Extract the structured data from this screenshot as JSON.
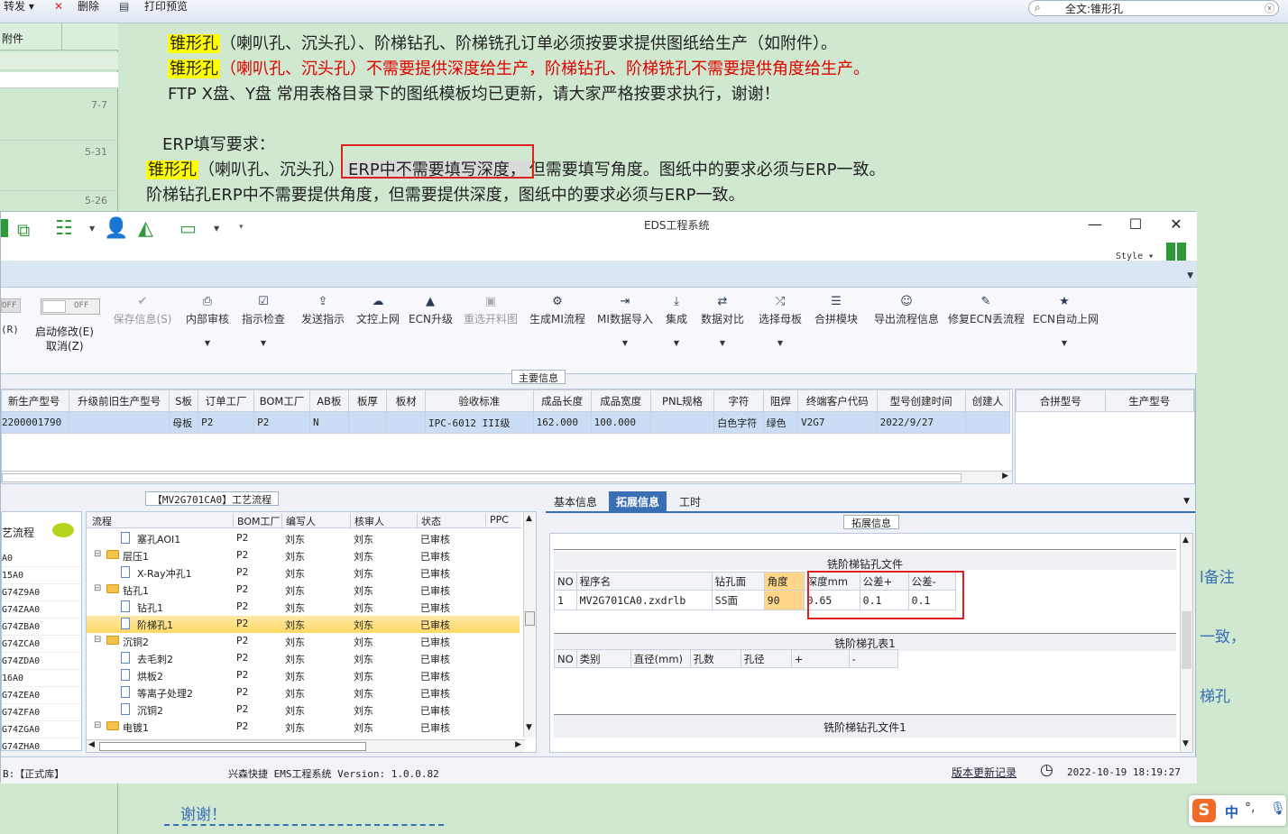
{
  "mail_toolbar": {
    "forward": "转发",
    "delete": "删除",
    "print": "打印预览",
    "search_value": "全文:锥形孔"
  },
  "mail_list": {
    "col_header": "附件",
    "dates": [
      "7-7",
      "5-31",
      "5-26"
    ]
  },
  "mail_body": {
    "line1_hl": "锥形孔",
    "line1": "（喇叭孔、沉头孔）、阶梯钻孔、阶梯铣孔订单必须按要求提供图纸给生产（如附件）。",
    "line2_hl": "锥形孔",
    "line2": "（喇叭孔、沉头孔）不需要提供深度给生产，阶梯钻孔、阶梯铣孔不需要提供角度给生产。",
    "line3": "FTP X盘、Y盘 常用表格目录下的图纸模板均已更新，请大家严格按要求执行，谢谢！",
    "line4": "ERP填写要求：",
    "line5_hl": "锥形孔",
    "line5a": "（喇叭孔、沉头孔）",
    "line5b": "ERP中不需要填写深度，",
    "line5c": "但需要填写角度。图纸中的要求必须与ERP一致。",
    "line6": "阶梯钻孔ERP中不需要提供角度，但需要提供深度，图纸中的要求必须与ERP一致。",
    "thanks": "谢谢！",
    "right_frag1": "l备注",
    "right_frag2": "一致，",
    "right_frag3": "梯孔"
  },
  "window": {
    "title": "EDS工程系统",
    "style_label": "Style"
  },
  "ribbon": {
    "toggle_off": "OFF",
    "left_frag": "(R)",
    "enable_edit": "启动修改(E)",
    "cancel": "取消(Z)",
    "buttons": [
      {
        "icon": "check-icon",
        "label": "保存信息(S)",
        "disabled": true
      },
      {
        "icon": "print-icon",
        "label": "内部审核"
      },
      {
        "icon": "checkbox-icon",
        "label": "指示检查"
      },
      {
        "icon": "upload-icon",
        "label": "发送指示"
      },
      {
        "icon": "cloud-upload-icon",
        "label": "文控上网"
      },
      {
        "icon": "ecn-icon",
        "label": "ECN升级"
      },
      {
        "icon": "image-icon",
        "label": "重选开料图",
        "disabled": true
      },
      {
        "icon": "gears-icon",
        "label": "生成MI流程"
      },
      {
        "icon": "import-icon",
        "label": "MI数据导入"
      },
      {
        "icon": "download-icon",
        "label": "集成"
      },
      {
        "icon": "compare-icon",
        "label": "数据对比"
      },
      {
        "icon": "shuffle-icon",
        "label": "选择母板"
      },
      {
        "icon": "list-icon",
        "label": "合拼模块"
      },
      {
        "icon": "smile-icon",
        "label": "导出流程信息"
      },
      {
        "icon": "wrench-icon",
        "label": "修复ECN丢流程"
      },
      {
        "icon": "star-icon",
        "label": "ECN自动上网"
      }
    ]
  },
  "main_info": {
    "section_title": "主要信息",
    "headers": [
      "新生产型号",
      "升级前旧生产型号",
      "S板",
      "订单工厂",
      "BOM工厂",
      "AB板",
      "板厚",
      "板材",
      "验收标准",
      "成品长度",
      "成品宽度",
      "PNL规格",
      "字符",
      "阻焊",
      "终端客户代码",
      "型号创建时间",
      "创建人"
    ],
    "row": [
      "2200001790",
      "",
      "母板",
      "P2",
      "P2",
      "N",
      "",
      "",
      "IPC-6012 III级",
      "162.000",
      "100.000",
      "",
      "白色字符",
      "绿色",
      "V2G7",
      "2022/9/27",
      ""
    ],
    "right_headers": [
      "合拼型号",
      "生产型号"
    ]
  },
  "process": {
    "group_title": "【MV2G701CA0】工艺流程",
    "left_header": "艺流程",
    "left_items": [
      "A0",
      "15A0",
      "G74Z9A0",
      "G74ZAA0",
      "G74ZBA0",
      "G74ZCA0",
      "G74ZDA0",
      "16A0",
      "G74ZEA0",
      "G74ZFA0",
      "G74ZGA0",
      "G74ZHA0"
    ],
    "columns": [
      "流程",
      "BOM工厂",
      "编写人",
      "核审人",
      "状态",
      "PPC"
    ],
    "rows": [
      {
        "name": "塞孔AOI1",
        "level": 2,
        "type": "doc",
        "bom": "P2",
        "writer": "刘东",
        "auditor": "刘东",
        "status": "已审核"
      },
      {
        "name": "层压1",
        "level": 1,
        "type": "folder",
        "bom": "P2",
        "writer": "刘东",
        "auditor": "刘东",
        "status": "已审核"
      },
      {
        "name": "X-Ray冲孔1",
        "level": 2,
        "type": "doc",
        "bom": "P2",
        "writer": "刘东",
        "auditor": "刘东",
        "status": "已审核"
      },
      {
        "name": "钻孔1",
        "level": 1,
        "type": "folder",
        "bom": "P2",
        "writer": "刘东",
        "auditor": "刘东",
        "status": "已审核"
      },
      {
        "name": "钻孔1",
        "level": 2,
        "type": "doc",
        "bom": "P2",
        "writer": "刘东",
        "auditor": "刘东",
        "status": "已审核"
      },
      {
        "name": "阶梯孔1",
        "level": 2,
        "type": "doc",
        "bom": "P2",
        "writer": "刘东",
        "auditor": "刘东",
        "status": "已审核",
        "selected": true
      },
      {
        "name": "沉铜2",
        "level": 1,
        "type": "folder",
        "bom": "P2",
        "writer": "刘东",
        "auditor": "刘东",
        "status": "已审核"
      },
      {
        "name": "去毛刺2",
        "level": 2,
        "type": "doc",
        "bom": "P2",
        "writer": "刘东",
        "auditor": "刘东",
        "status": "已审核"
      },
      {
        "name": "烘板2",
        "level": 2,
        "type": "doc",
        "bom": "P2",
        "writer": "刘东",
        "auditor": "刘东",
        "status": "已审核"
      },
      {
        "name": "等离子处理2",
        "level": 2,
        "type": "doc",
        "bom": "P2",
        "writer": "刘东",
        "auditor": "刘东",
        "status": "已审核"
      },
      {
        "name": "沉铜2",
        "level": 2,
        "type": "doc",
        "bom": "P2",
        "writer": "刘东",
        "auditor": "刘东",
        "status": "已审核"
      },
      {
        "name": "电镀1",
        "level": 1,
        "type": "folder",
        "bom": "P2",
        "writer": "刘东",
        "auditor": "刘东",
        "status": "已审核"
      }
    ]
  },
  "detail": {
    "tabs": [
      "基本信息",
      "拓展信息",
      "工时"
    ],
    "active_tab": 1,
    "group_title": "拓展信息",
    "file_section": "铣阶梯钻孔文件",
    "file_headers": [
      "NO",
      "程序名",
      "钻孔面",
      "角度",
      "深度mm",
      "公差+",
      "公差-"
    ],
    "file_row": [
      "1",
      "MV2G701CA0.zxdrlb",
      "SS面",
      "90",
      "0.65",
      "0.1",
      "0.1"
    ],
    "table_section": "铣阶梯孔表1",
    "table_headers": [
      "NO",
      "类别",
      "直径(mm)",
      "孔数",
      "孔径",
      "+",
      "-"
    ],
    "file_section2": "铣阶梯钻孔文件1"
  },
  "status_bar": {
    "db": "B:【正式库】",
    "app": "兴森快捷 EMS工程系统 Version: 1.0.0.82",
    "link": "版本更新记录",
    "datetime": "2022-10-19 18:19:27"
  },
  "ime": {
    "logo": "S",
    "mode": "中",
    "punct": "°,"
  },
  "colors": {
    "highlight": "#ffff00",
    "red_text": "#e00000",
    "accent": "#3a6fb5",
    "selection": "#c9def5",
    "tree_selected": "#ffd966"
  }
}
